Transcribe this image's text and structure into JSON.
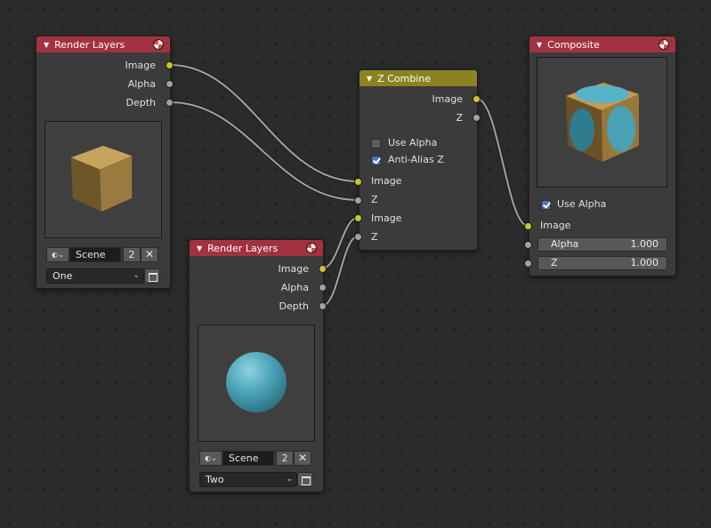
{
  "colors": {
    "header_render": "#a33240",
    "header_zcombine": "#8b8322",
    "socket_color": "#c7c729",
    "socket_value": "#a1a1a1",
    "wire": "#9a9a9a",
    "checkbox_checked": "#4a72c2"
  },
  "render_layers_1": {
    "title": "Render Layers",
    "icon": "render-icon",
    "outputs": [
      "Image",
      "Alpha",
      "Depth"
    ],
    "preview": "cube-preview",
    "scene_name": "Scene",
    "scene_users": "2",
    "scene_clear": "✕",
    "layer": "One"
  },
  "render_layers_2": {
    "title": "Render Layers",
    "icon": "render-icon",
    "outputs": [
      "Image",
      "Alpha",
      "Depth"
    ],
    "preview": "sphere-preview",
    "scene_name": "Scene",
    "scene_users": "2",
    "scene_clear": "✕",
    "layer": "Two"
  },
  "z_combine": {
    "title": "Z Combine",
    "outputs": [
      "Image",
      "Z"
    ],
    "use_alpha_label": "Use Alpha",
    "use_alpha_checked": false,
    "anti_alias_label": "Anti-Alias Z",
    "anti_alias_checked": true,
    "inputs": [
      "Image",
      "Z",
      "Image",
      "Z"
    ]
  },
  "composite": {
    "title": "Composite",
    "icon": "render-icon",
    "preview": "cube-sphere-composite-preview",
    "use_alpha_label": "Use Alpha",
    "use_alpha_checked": true,
    "input_image": "Image",
    "alpha_label": "Alpha",
    "alpha_value": "1.000",
    "z_label": "Z",
    "z_value": "1.000"
  }
}
